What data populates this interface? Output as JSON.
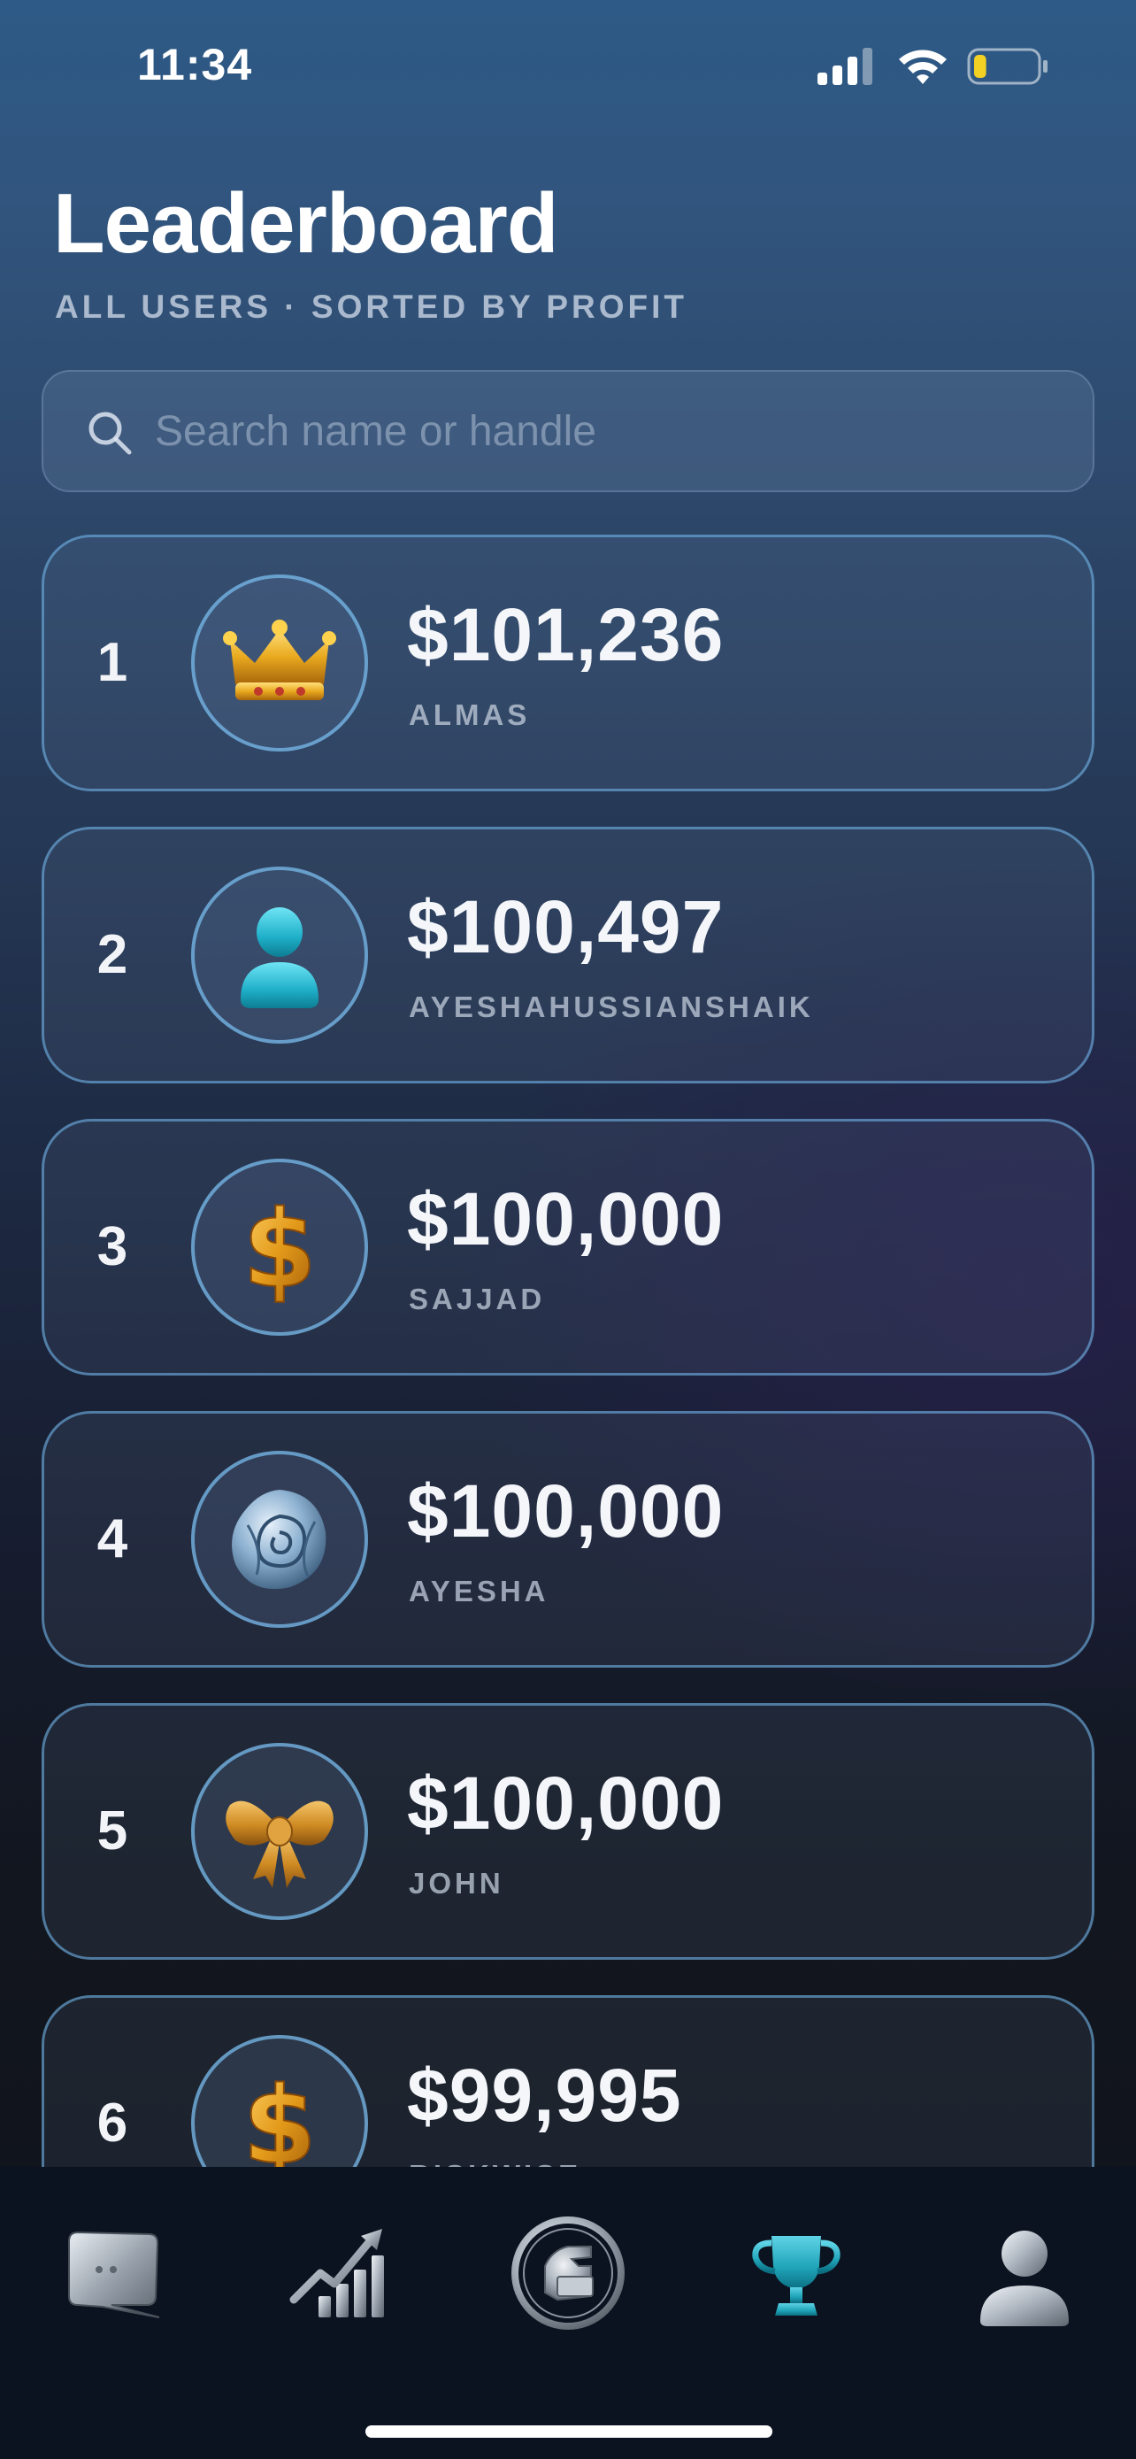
{
  "status_bar": {
    "time": "11:34",
    "battery_level": 0.2,
    "battery_color": "#f2d024"
  },
  "header": {
    "title": "Leaderboard",
    "subtitle": "ALL USERS · SORTED BY PROFIT"
  },
  "search": {
    "placeholder": "Search name or handle",
    "value": ""
  },
  "leaderboard": {
    "rows": [
      {
        "rank": "1",
        "amount": "$101,236",
        "handle": "ALMAS",
        "avatar_icon": "crown-icon"
      },
      {
        "rank": "2",
        "amount": "$100,497",
        "handle": "AYESHAHUSSIANSHAIK",
        "avatar_icon": "person-icon"
      },
      {
        "rank": "3",
        "amount": "$100,000",
        "handle": "SAJJAD",
        "avatar_icon": "dollar-icon"
      },
      {
        "rank": "4",
        "amount": "$100,000",
        "handle": "AYESHA",
        "avatar_icon": "rose-icon"
      },
      {
        "rank": "5",
        "amount": "$100,000",
        "handle": "JOHN",
        "avatar_icon": "bow-icon"
      },
      {
        "rank": "6",
        "amount": "$99,995",
        "handle": "RISKWISE",
        "avatar_icon": "dollar-icon"
      }
    ]
  },
  "tab_bar": {
    "tabs": [
      {
        "icon": "chat-bubble-icon",
        "active": false
      },
      {
        "icon": "growth-chart-icon",
        "active": false
      },
      {
        "icon": "trade-coin-icon",
        "active": false
      },
      {
        "icon": "trophy-icon",
        "active": true
      },
      {
        "icon": "profile-icon",
        "active": false
      }
    ],
    "active_color": "#1fa3b8"
  },
  "colors": {
    "card_border": "#6eafe1",
    "accent_teal": "#1fa3b8",
    "gold": "#e0a21c"
  }
}
